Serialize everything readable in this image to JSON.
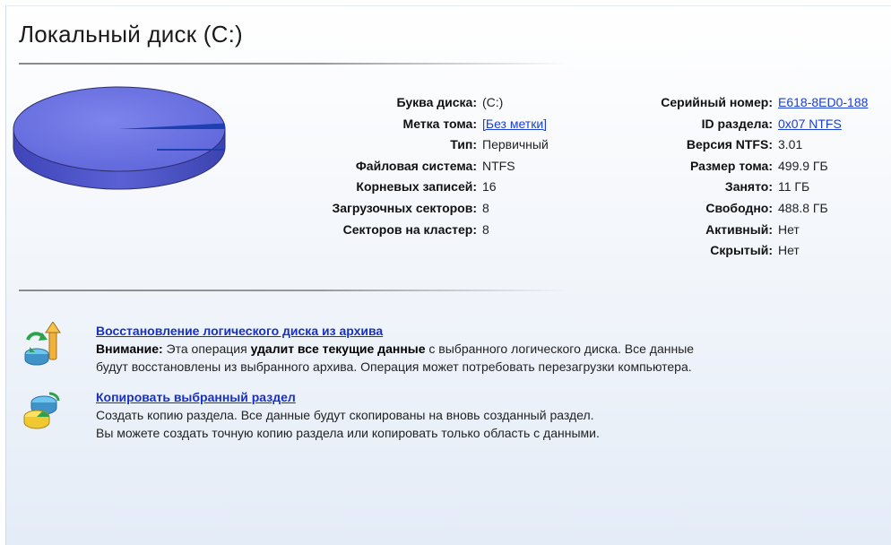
{
  "title": "Локальный диск (C:)",
  "left_info": [
    {
      "label": "Буква диска:",
      "value": "(C:)",
      "is_link": false
    },
    {
      "label": "Метка тома:",
      "value": "[Без метки]",
      "is_link": true
    },
    {
      "label": "Тип:",
      "value": "Первичный",
      "is_link": false
    },
    {
      "label": "Файловая система:",
      "value": "NTFS",
      "is_link": false
    },
    {
      "label": "Корневых записей:",
      "value": "16",
      "is_link": false
    },
    {
      "label": "Загрузочных секторов:",
      "value": "8",
      "is_link": false
    },
    {
      "label": "Секторов на кластер:",
      "value": "8",
      "is_link": false
    }
  ],
  "right_info": [
    {
      "label": "Серийный номер:",
      "value": "E618-8ED0-188",
      "is_link": true
    },
    {
      "label": "ID раздела:",
      "value": "0x07 NTFS",
      "is_link": true
    },
    {
      "label": "Версия NTFS:",
      "value": "3.01",
      "is_link": false
    },
    {
      "label": "Размер тома:",
      "value": "499.9 ГБ",
      "is_link": false
    },
    {
      "label": "Занято:",
      "value": "11 ГБ",
      "is_link": false
    },
    {
      "label": "Свободно:",
      "value": "488.8 ГБ",
      "is_link": false
    },
    {
      "label": "Активный:",
      "value": "Нет",
      "is_link": false
    },
    {
      "label": "Скрытый:",
      "value": "Нет",
      "is_link": false
    }
  ],
  "pie": {
    "used_fraction": 0.022,
    "free_color": "#6b72e0",
    "used_color": "#1d3fb0"
  },
  "actions": [
    {
      "icon": "restore-archive-icon",
      "link": "Восстановление логического диска из архива",
      "line1_prefix_bold": "Внимание:",
      "line1_text1": " Эта операция ",
      "line1_bold": "удалит все текущие данные",
      "line1_text2": " с выбранного логического диска. Все данные",
      "line2": "будут восстановлены из выбранного архива. Операция может потребовать перезагрузки компьютера."
    },
    {
      "icon": "copy-partition-icon",
      "link": "Копировать выбранный раздел",
      "line1": "Создать копию раздела. Все данные будут скопированы на вновь созданный раздел.",
      "line2": "Вы можете создать точную копию раздела или копировать только область с данными."
    }
  ],
  "colors": {
    "link": "#1c3fd6",
    "accent": "#6b72e0"
  }
}
